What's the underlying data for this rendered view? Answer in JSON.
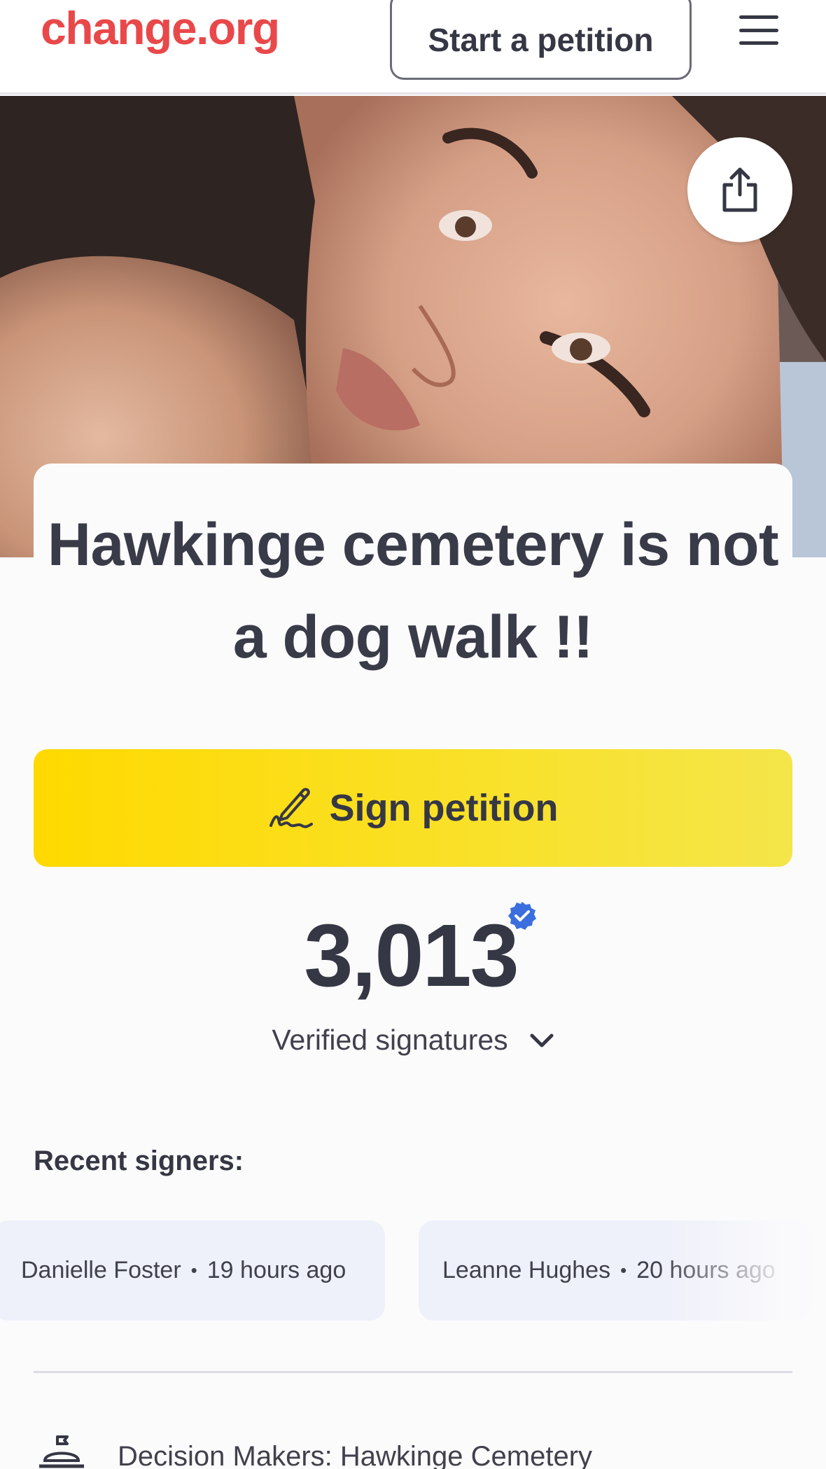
{
  "header": {
    "logo_text": "change.org",
    "start_petition_label": "Start a petition",
    "menu_icon": "hamburger-menu-icon"
  },
  "hero": {
    "share_icon": "share-icon"
  },
  "petition": {
    "title": "Hawkinge cemetery is not a dog walk !!",
    "sign_label": "Sign petition",
    "sign_icon": "signature-pen-icon"
  },
  "signatures": {
    "count": "3,013",
    "label": "Verified signatures",
    "badge_icon": "verified-badge-icon",
    "expand_icon": "chevron-down-icon"
  },
  "recent": {
    "title": "Recent signers:",
    "signers": [
      {
        "name": "Danielle Foster",
        "time": "19 hours ago"
      },
      {
        "name": "Leanne Hughes",
        "time": "20 hours ago"
      }
    ]
  },
  "decision_makers": {
    "text": "Decision Makers: Hawkinge Cemetery",
    "icon": "decision-maker-icon"
  },
  "colors": {
    "brand_red": "#e9484a",
    "sign_yellow": "#ffd900",
    "text_dark": "#363744",
    "verified_blue": "#3b6fe0",
    "chip_bg": "#eef0fa"
  }
}
